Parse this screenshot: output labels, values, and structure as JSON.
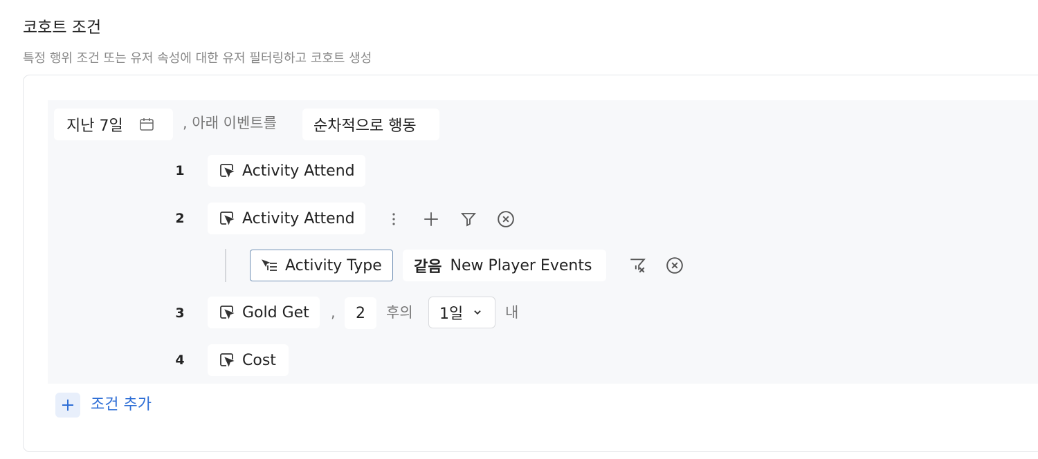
{
  "header": {
    "title": "코호트 조건",
    "subtitle": "특정 행위 조건 또는 유저 속성에 대한 유저 필터링하고 코호트 생성"
  },
  "condition": {
    "period_label": "지난 7일",
    "connector": ", 아래 이벤트를",
    "mode_label": "순차적으로 행동"
  },
  "steps": [
    {
      "num": "1",
      "event": "Activity Attend"
    },
    {
      "num": "2",
      "event": "Activity Attend"
    },
    {
      "num": "3",
      "event": "Gold Get"
    },
    {
      "num": "4",
      "event": "Cost"
    }
  ],
  "filter": {
    "property": "Activity Type",
    "operator": "같음",
    "value": "New Player Events"
  },
  "step3_timing": {
    "comma": ",",
    "count": "2",
    "after_label": "후의",
    "window_value": "1일",
    "within_label": "내"
  },
  "add_condition": {
    "label": "조건 추가"
  },
  "colors": {
    "accent": "#2f6fd6",
    "panel_bg": "#f7f8fa",
    "border": "#e3e5e8",
    "muted_text": "#777777"
  },
  "icons": {
    "period": "calendar-icon",
    "event": "event-cursor-icon",
    "more": "more-vertical-icon",
    "add": "plus-icon",
    "filter": "filter-icon",
    "remove": "close-circle-icon",
    "property": "property-list-icon",
    "filter_clear": "filter-clear-icon",
    "dropdown": "chevron-down-icon"
  }
}
